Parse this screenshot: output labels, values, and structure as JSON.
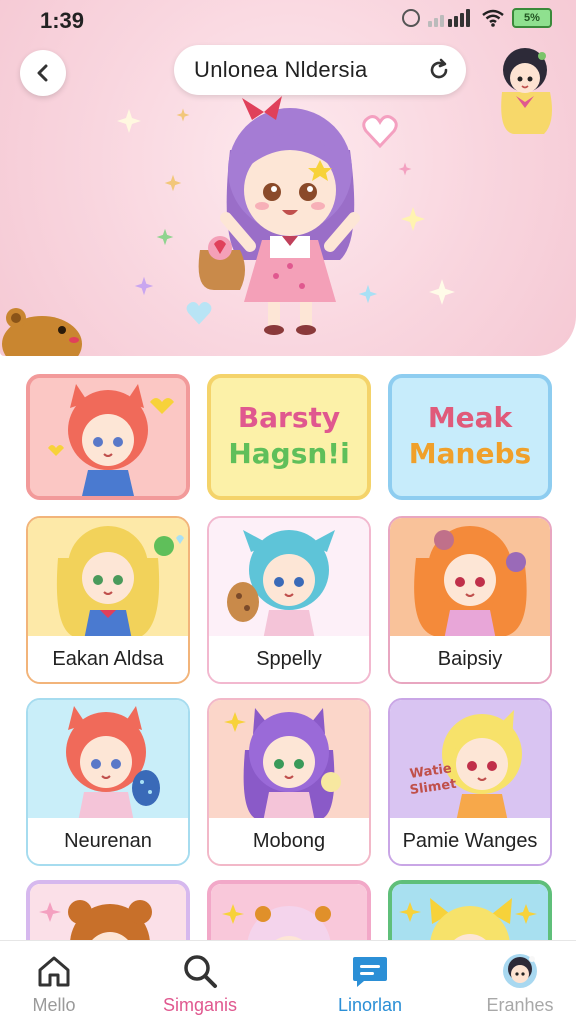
{
  "status_bar": {
    "time": "1:39",
    "battery": "5%"
  },
  "header": {
    "title": "Unlonea Nldersia"
  },
  "cards": [
    {
      "label": ""
    },
    {
      "label": "",
      "banner": [
        "Barsty",
        "Hagsn!i"
      ]
    },
    {
      "label": "",
      "banner": [
        "Meak",
        "Manebs"
      ]
    },
    {
      "label": "Eakan Aldsa"
    },
    {
      "label": "Sppelly"
    },
    {
      "label": "Baipsiy"
    },
    {
      "label": "Neurenan"
    },
    {
      "label": "Mobong"
    },
    {
      "label": "Pamie Wanges",
      "sticker": [
        "Watie",
        "Slimet"
      ]
    },
    {
      "label": ""
    },
    {
      "label": ""
    },
    {
      "label": ""
    }
  ],
  "nav": [
    {
      "label": "Mello",
      "icon": "home-icon",
      "color": "#9a9a9a"
    },
    {
      "label": "Simganis",
      "icon": "search-icon",
      "color": "#e0588f"
    },
    {
      "label": "Linorlan",
      "icon": "chat-icon",
      "color": "#2b8fd6"
    },
    {
      "label": "Eranhes",
      "icon": "avatar-icon",
      "color": "#a8a8a8"
    }
  ],
  "colors": {
    "hero_bg": "#f9d6df",
    "accent_pink": "#e0588f",
    "accent_blue": "#2b8fd6"
  }
}
